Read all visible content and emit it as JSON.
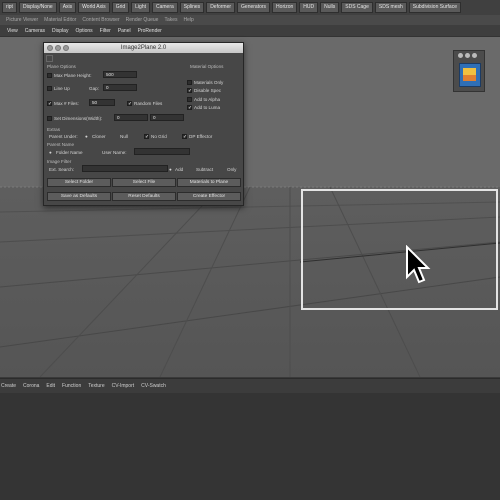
{
  "toolbar_main": {
    "items": [
      "ript",
      "Display/None",
      "Axis",
      "World Axis",
      "Grid",
      "Light",
      "Camera",
      "Splines",
      "Deformer",
      "Generators",
      "Horizon",
      "HUD",
      "Nulls",
      "SDS Cage",
      "SDS mesh",
      "Subdivision Surface"
    ]
  },
  "toolbar_secondary": {
    "items": [
      "Picture Viewer",
      "Material Editor",
      "Content Browser",
      "Render Queue",
      "Takes",
      "Help"
    ]
  },
  "viewport_menu": {
    "items": [
      "View",
      "Cameras",
      "Display",
      "Options",
      "Filter",
      "Panel",
      "ProRender"
    ]
  },
  "dialog": {
    "title": "Image2Plane 2.0",
    "plane_options_header": "Plane Options",
    "material_options_header": "Material Options",
    "max_plane_height_label": "Max Plane Height:",
    "max_plane_height_value": "500",
    "line_up_label": "Line Up",
    "gap_label": "Gap:",
    "gap_value": "0",
    "max_files_label": "Max # Files:",
    "max_files_value": "50",
    "random_files_label": "Random Files",
    "set_dimensions_label": "Set Dimensions(Width):",
    "dim_width_value": "0",
    "dim_height_value": "0",
    "materials_only_label": "Materials Only",
    "disable_spec_label": "Disable Spec",
    "add_to_alpha_label": "Add to Alpha",
    "add_to_luma_label": "Add to Luma",
    "extras_header": "Extras",
    "parent_under_label": "Parent Under:",
    "cloner_label": "Cloner",
    "null_label": "Null",
    "no_grid_label": "No Grid",
    "dp_effector_label": "DP Effector",
    "parent_name_header": "Parent Name",
    "folder_name_label": "Folder Name",
    "user_name_label": "User Name:",
    "image_filter_header": "Image Filter",
    "ext_search_label": "Ext. Search:",
    "add_label": "Add",
    "subtract_label": "Subtract",
    "only_label": "Only",
    "select_folder_button": "Select Folder",
    "select_file_button": "Select File",
    "materials_to_plane_button": "Materials to Plane",
    "save_defaults_button": "Save as Defaults",
    "reset_defaults_button": "Reset Defaults",
    "create_effector_button": "Create Effector"
  },
  "bottom_bar": {
    "items": [
      "Create",
      "Corona",
      "Edit",
      "Function",
      "Texture",
      "CV-Import",
      "CV-Swatch"
    ]
  },
  "colors": {
    "viewport_top": "#6a6a6a",
    "viewport_floor": "#5a5a5a",
    "dialog_bg": "#474747",
    "accent_selection": "#e4e4e4"
  }
}
